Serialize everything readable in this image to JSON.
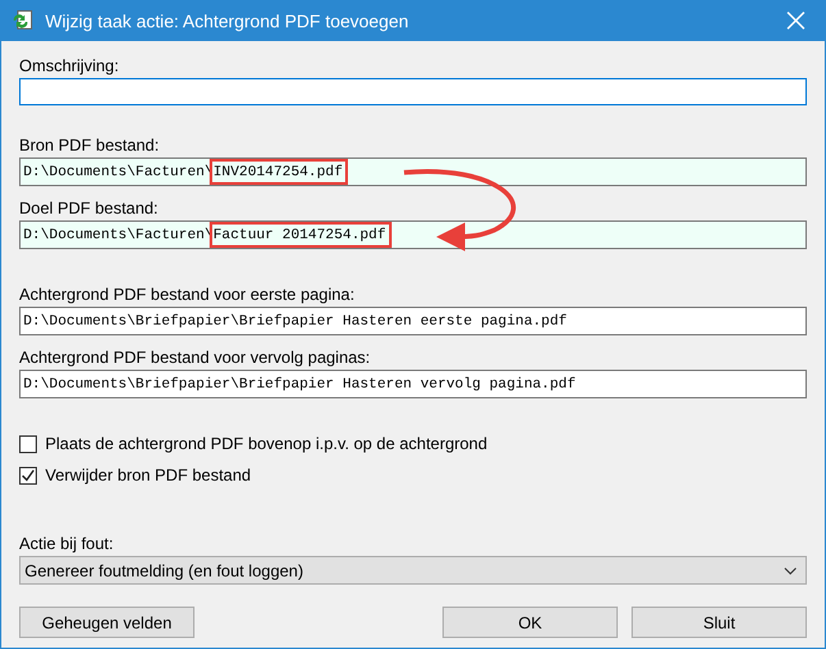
{
  "window": {
    "title": "Wijzig taak actie: Achtergrond PDF toevoegen"
  },
  "description": {
    "label": "Omschrijving:",
    "focused": true
  },
  "files": [
    {
      "label": "Bron PDF bestand:",
      "path": "D:\\Documents\\Facturen\\",
      "highlight": "INV20147254.pdf",
      "readonly": true
    },
    {
      "label": "Doel PDF bestand:",
      "path": "D:\\Documents\\Facturen\\",
      "highlight": "Factuur 20147254.pdf",
      "readonly": true
    }
  ],
  "backgrounds": [
    {
      "label": "Achtergrond PDF bestand voor eerste pagina:",
      "path": "D:\\Documents\\Briefpapier\\Briefpapier Hasteren eerste pagina.pdf",
      "readonly": false
    },
    {
      "label": "Achtergrond PDF bestand voor vervolg paginas:",
      "path": "D:\\Documents\\Briefpapier\\Briefpapier Hasteren vervolg pagina.pdf",
      "readonly": false
    }
  ],
  "options": [
    {
      "label": "Plaats de achtergrond PDF bovenop i.p.v. op de achtergrond",
      "checked": false
    },
    {
      "label": "Verwijder bron PDF bestand",
      "checked": true
    }
  ],
  "error_action": {
    "label": "Actie bij fout:",
    "value": "Genereer foutmelding (en fout loggen)"
  },
  "buttons": {
    "left": [
      "Geheugen velden"
    ],
    "right": [
      "OK",
      "Sluit"
    ]
  }
}
